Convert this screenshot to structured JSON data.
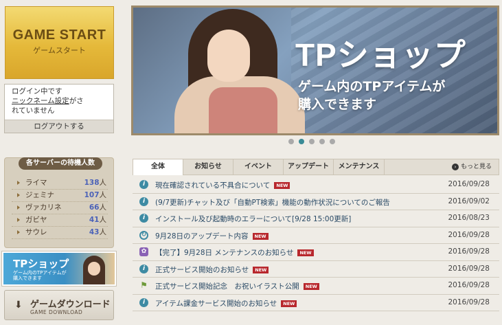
{
  "game_start": {
    "title": "GAME START",
    "subtitle": "ゲームスタート"
  },
  "login": {
    "line1": "ログイン中です",
    "link": "ニックネーム設定",
    "line2a": "がさ",
    "line3": "れていません",
    "logout": "ログアウトする"
  },
  "servers": {
    "title": "各サーバーの待機人数",
    "unit": "人",
    "items": [
      {
        "name": "ライマ",
        "count": "138"
      },
      {
        "name": "ジェミナ",
        "count": "107"
      },
      {
        "name": "ヴァカリネ",
        "count": "66"
      },
      {
        "name": "ガビヤ",
        "count": "41"
      },
      {
        "name": "サウレ",
        "count": "43"
      }
    ]
  },
  "tp_small": {
    "title": "TPショップ",
    "line1": "ゲーム内のTPアイテムが",
    "line2": "購入できます"
  },
  "download": {
    "label": "ゲームダウンロード",
    "sub": "GAME DOWNLOAD"
  },
  "banner": {
    "title": "TPショップ",
    "sub1": "ゲーム内のTPアイテムが",
    "sub2": "購入できます"
  },
  "carousel": {
    "count": 5,
    "active": 1
  },
  "news": {
    "tabs": [
      "全体",
      "お知らせ",
      "イベント",
      "アップデート",
      "メンテナンス"
    ],
    "more": "もっと見る",
    "new_label": "NEW",
    "items": [
      {
        "icon": "info",
        "title": "現在確認されている不具合について",
        "new": true,
        "date": "2016/09/28"
      },
      {
        "icon": "info",
        "title": "(9/7更新)チャット及び「自動PT検索」機能の動作状況についてのご報告",
        "new": false,
        "date": "2016/09/02"
      },
      {
        "icon": "info",
        "title": "インストール及び起動時のエラーについて[9/28 15:00更新]",
        "new": false,
        "date": "2016/08/23"
      },
      {
        "icon": "update",
        "title": "9月28日のアップデート内容",
        "new": true,
        "date": "2016/09/28"
      },
      {
        "icon": "maint",
        "title": "【完了】9月28日 メンテナンスのお知らせ",
        "new": true,
        "date": "2016/09/28"
      },
      {
        "icon": "info",
        "title": "正式サービス開始のお知らせ",
        "new": true,
        "date": "2016/09/28"
      },
      {
        "icon": "flag",
        "title": "正式サービス開始記念　お祝いイラスト公開",
        "new": true,
        "date": "2016/09/28"
      },
      {
        "icon": "info",
        "title": "アイテム課金サービス開始のお知らせ",
        "new": true,
        "date": "2016/09/28"
      }
    ]
  }
}
